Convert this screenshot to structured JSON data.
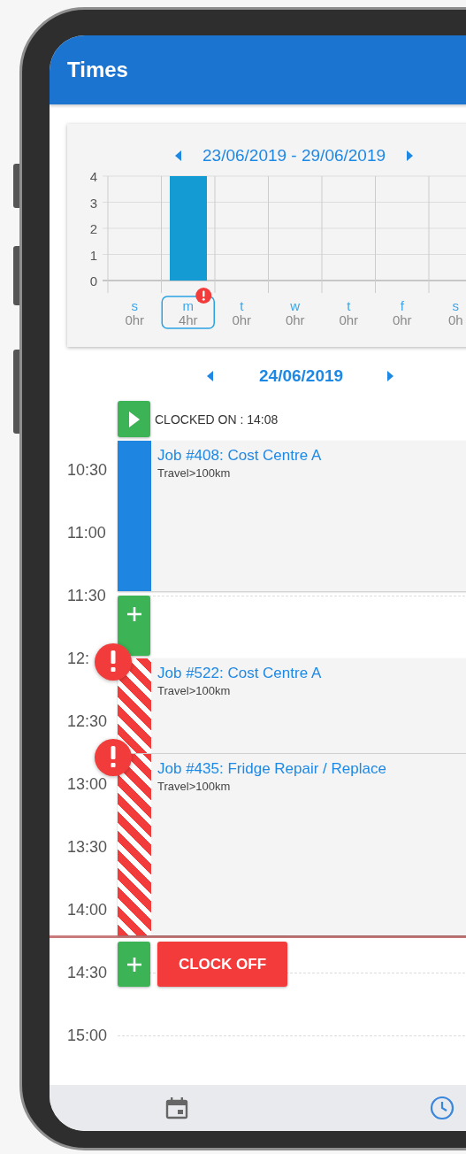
{
  "app_bar": {
    "title": "Times"
  },
  "week": {
    "range": "23/06/2019 - 29/06/2019",
    "chart_data": {
      "type": "bar",
      "categories": [
        "s",
        "m",
        "t",
        "w",
        "t",
        "f",
        "s"
      ],
      "values": [
        0,
        4,
        0,
        0,
        0,
        0,
        0
      ],
      "ylim": [
        0,
        4
      ],
      "yticks": [
        0,
        1,
        2,
        3,
        4
      ],
      "grid": true
    },
    "days": [
      {
        "hours": "0hr",
        "selected": false,
        "alert": false
      },
      {
        "hours": "4hr",
        "selected": true,
        "alert": true
      },
      {
        "hours": "0hr",
        "selected": false,
        "alert": false
      },
      {
        "hours": "0hr",
        "selected": false,
        "alert": false
      },
      {
        "hours": "0hr",
        "selected": false,
        "alert": false
      },
      {
        "hours": "0hr",
        "selected": false,
        "alert": false
      },
      {
        "hours": "0h",
        "selected": false,
        "alert": false
      }
    ]
  },
  "day": {
    "date": "24/06/2019"
  },
  "timeline": {
    "times": [
      "10:30",
      "11:00",
      "11:30",
      "12:",
      "12:30",
      "13:00",
      "13:30",
      "14:00",
      "14:30",
      "15:00"
    ],
    "entries": [
      {
        "kind": "clock_on",
        "label": "CLOCKED ON : 14:08"
      },
      {
        "kind": "job",
        "title": "Job #408: Cost Centre A",
        "subtitle": "Travel>100km",
        "alert": false
      },
      {
        "kind": "add"
      },
      {
        "kind": "job",
        "title": "Job #522: Cost Centre A",
        "subtitle": "Travel>100km",
        "alert": true
      },
      {
        "kind": "job",
        "title": "Job #435: Fridge Repair / Replace",
        "subtitle": "Travel>100km",
        "alert": true
      },
      {
        "kind": "current_time"
      },
      {
        "kind": "clock_off",
        "button": "CLOCK OFF"
      }
    ]
  },
  "bottom_nav": {
    "items": [
      {
        "kind": "calendar",
        "selected": false
      },
      {
        "kind": "clock",
        "selected": true
      }
    ]
  }
}
